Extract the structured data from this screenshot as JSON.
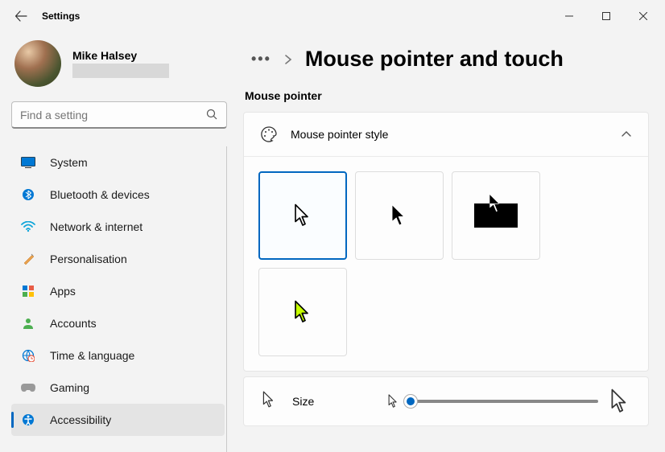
{
  "app": {
    "title": "Settings"
  },
  "user": {
    "name": "Mike Halsey"
  },
  "search": {
    "placeholder": "Find a setting"
  },
  "nav": {
    "items": [
      {
        "label": "System"
      },
      {
        "label": "Bluetooth & devices"
      },
      {
        "label": "Network & internet"
      },
      {
        "label": "Personalisation"
      },
      {
        "label": "Apps"
      },
      {
        "label": "Accounts"
      },
      {
        "label": "Time & language"
      },
      {
        "label": "Gaming"
      },
      {
        "label": "Accessibility"
      }
    ]
  },
  "breadcrumb": {
    "title": "Mouse pointer and touch"
  },
  "section": {
    "label": "Mouse pointer"
  },
  "style_card": {
    "title": "Mouse pointer style"
  },
  "size_card": {
    "label": "Size"
  },
  "colors": {
    "accent": "#0067c0"
  }
}
